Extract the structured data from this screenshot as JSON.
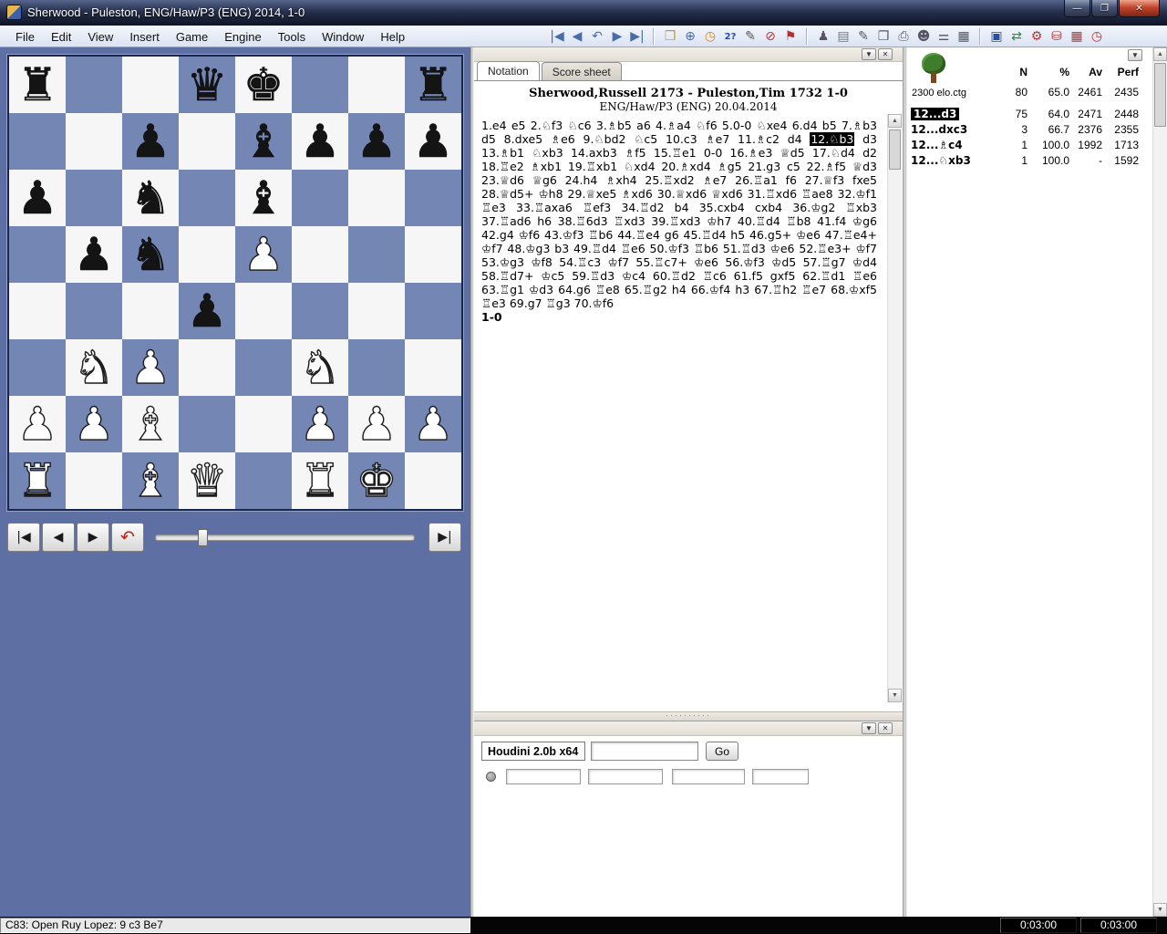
{
  "window": {
    "title": "Sherwood - Puleston, ENG/Haw/P3 (ENG) 2014, 1-0",
    "buttons": {
      "minimize": "—",
      "maximize": "❐",
      "close": "✕"
    }
  },
  "menu": {
    "items": [
      "File",
      "Edit",
      "View",
      "Insert",
      "Game",
      "Engine",
      "Tools",
      "Window",
      "Help"
    ]
  },
  "toolbar": {
    "icons": [
      {
        "name": "goto-start-icon",
        "glyph": "|◀",
        "color": "#4a6da8"
      },
      {
        "name": "back-icon",
        "glyph": "◀",
        "color": "#4a6da8"
      },
      {
        "name": "unplay-move-icon",
        "glyph": "↶",
        "color": "#4a6da8"
      },
      {
        "name": "forward-icon",
        "glyph": "▶",
        "color": "#4a6da8"
      },
      {
        "name": "goto-end-icon",
        "glyph": "▶|",
        "color": "#4a6da8"
      },
      {
        "sep": true
      },
      {
        "name": "new-game-folder-icon",
        "glyph": "❒",
        "color": "#c09a2e"
      },
      {
        "name": "globe-icon",
        "glyph": "⊕",
        "color": "#3a6fb0"
      },
      {
        "name": "clock-icon",
        "glyph": "◷",
        "color": "#d9861f"
      },
      {
        "name": "training-icon",
        "glyph": "2?",
        "color": "#2a4fa0",
        "small": true
      },
      {
        "name": "annotate-pencil-icon",
        "glyph": "✎",
        "color": "#555555"
      },
      {
        "name": "no-entry-icon",
        "glyph": "⊘",
        "color": "#c23333"
      },
      {
        "name": "flag-icon",
        "glyph": "⚑",
        "color": "#b03030"
      },
      {
        "sep": true
      },
      {
        "name": "best-line-icon",
        "glyph": "♟",
        "color": "#555566"
      },
      {
        "name": "opening-book-icon",
        "glyph": "▤",
        "color": "#777777"
      },
      {
        "name": "edit-game-data-icon",
        "glyph": "✎",
        "color": "#556"
      },
      {
        "name": "new-board-window-icon",
        "glyph": "❐",
        "color": "#556"
      },
      {
        "name": "print-icon",
        "glyph": "⎙",
        "color": "#556"
      },
      {
        "name": "player-info-icon",
        "glyph": "☻",
        "color": "#556"
      },
      {
        "name": "material-columns-icon",
        "glyph": "⚌",
        "color": "#556"
      },
      {
        "name": "board-grid-icon",
        "glyph": "▦",
        "color": "#556"
      },
      {
        "sep": true
      },
      {
        "name": "save-game-icon",
        "glyph": "▣",
        "color": "#2a4fa0"
      },
      {
        "name": "replace-game-icon",
        "glyph": "⇄",
        "color": "#2a8f3a"
      },
      {
        "name": "engine-gear-icon",
        "glyph": "⚙",
        "color": "#b33333"
      },
      {
        "name": "database-icon",
        "glyph": "⛁",
        "color": "#b33333"
      },
      {
        "name": "red-board-icon",
        "glyph": "▦",
        "color": "#b33333"
      },
      {
        "name": "red-clock-icon",
        "glyph": "◷",
        "color": "#b33333"
      }
    ]
  },
  "board": {
    "light_color": "#f6f6f6",
    "dark_color": "#7486b4",
    "pieces": [
      {
        "square": "a8",
        "color": "b",
        "type": "rook",
        "glyph": "♜"
      },
      {
        "square": "d8",
        "color": "b",
        "type": "queen",
        "glyph": "♛"
      },
      {
        "square": "e8",
        "color": "b",
        "type": "king",
        "glyph": "♚"
      },
      {
        "square": "h8",
        "color": "b",
        "type": "rook",
        "glyph": "♜"
      },
      {
        "square": "c7",
        "color": "b",
        "type": "pawn",
        "glyph": "♟"
      },
      {
        "square": "e7",
        "color": "b",
        "type": "bishop",
        "glyph": "♝"
      },
      {
        "square": "f7",
        "color": "b",
        "type": "pawn",
        "glyph": "♟"
      },
      {
        "square": "g7",
        "color": "b",
        "type": "pawn",
        "glyph": "♟"
      },
      {
        "square": "h7",
        "color": "b",
        "type": "pawn",
        "glyph": "♟"
      },
      {
        "square": "a6",
        "color": "b",
        "type": "pawn",
        "glyph": "♟"
      },
      {
        "square": "c6",
        "color": "b",
        "type": "knight",
        "glyph": "♞"
      },
      {
        "square": "e6",
        "color": "b",
        "type": "bishop",
        "glyph": "♝"
      },
      {
        "square": "b5",
        "color": "b",
        "type": "pawn",
        "glyph": "♟"
      },
      {
        "square": "c5",
        "color": "b",
        "type": "knight",
        "glyph": "♞"
      },
      {
        "square": "e5",
        "color": "w",
        "type": "pawn",
        "glyph": "♟"
      },
      {
        "square": "d4",
        "color": "b",
        "type": "pawn",
        "glyph": "♟"
      },
      {
        "square": "b3",
        "color": "w",
        "type": "knight",
        "glyph": "♞"
      },
      {
        "square": "c3",
        "color": "w",
        "type": "pawn",
        "glyph": "♟"
      },
      {
        "square": "f3",
        "color": "w",
        "type": "knight",
        "glyph": "♞"
      },
      {
        "square": "a2",
        "color": "w",
        "type": "pawn",
        "glyph": "♟"
      },
      {
        "square": "b2",
        "color": "w",
        "type": "pawn",
        "glyph": "♟"
      },
      {
        "square": "c2",
        "color": "w",
        "type": "bishop",
        "glyph": "♝"
      },
      {
        "square": "f2",
        "color": "w",
        "type": "pawn",
        "glyph": "♟"
      },
      {
        "square": "g2",
        "color": "w",
        "type": "pawn",
        "glyph": "♟"
      },
      {
        "square": "h2",
        "color": "w",
        "type": "pawn",
        "glyph": "♟"
      },
      {
        "square": "a1",
        "color": "w",
        "type": "rook",
        "glyph": "♜"
      },
      {
        "square": "c1",
        "color": "w",
        "type": "bishop",
        "glyph": "♝"
      },
      {
        "square": "d1",
        "color": "w",
        "type": "queen",
        "glyph": "♛"
      },
      {
        "square": "f1",
        "color": "w",
        "type": "rook",
        "glyph": "♜"
      },
      {
        "square": "g1",
        "color": "w",
        "type": "king",
        "glyph": "♚"
      }
    ]
  },
  "board_controls": {
    "buttons": [
      {
        "name": "board-goto-start-button",
        "glyph": "|◀"
      },
      {
        "name": "board-back-button",
        "glyph": "◀"
      },
      {
        "name": "board-forward-button",
        "glyph": "▶"
      },
      {
        "name": "board-unplay-button",
        "glyph": "↶"
      },
      {
        "name": "board-goto-end-button",
        "glyph": "▶|"
      }
    ],
    "slider_position": 0.17
  },
  "panel_buttons": {
    "menu": "▼",
    "close": "✕"
  },
  "scrollbar": {
    "up": "▲",
    "down": "▼"
  },
  "notation_panel": {
    "tabs": [
      "Notation",
      "Score sheet"
    ],
    "header_line1": "Sherwood,Russell 2173 - Puleston,Tim 1732  1-0",
    "header_line2": "ENG/Haw/P3 (ENG) 20.04.2014",
    "moves_before": "1.e4 e5 2.♘f3 ♘c6 3.♗b5 a6 4.♗a4 ♘f6 5.0-0 ♘xe4 6.d4 b5 7.♗b3 d5 8.dxe5 ♗e6 9.♘bd2 ♘c5 10.c3 ♗e7 11.♗c2 d4 ",
    "current_move": "12.♘b3",
    "moves_after": " d3 13.♗b1 ♘xb3 14.axb3 ♗f5 15.♖e1 0-0 16.♗e3 ♕d5 17.♘d4 d2 18.♖e2 ♗xb1 19.♖xb1 ♘xd4 20.♗xd4 ♗g5 21.g3 c5 22.♗f5 ♕d3 23.♕d6 ♕g6 24.h4 ♗xh4 25.♖xd2 ♗e7 26.♖a1 f6 27.♕f3 fxe5 28.♕d5+ ♔h8 29.♕xe5 ♗xd6 30.♕xd6 ♕xd6 31.♖xd6 ♖ae8 32.♔f1 ♖e3 33.♖axa6 ♖ef3 34.♖d2 b4 35.cxb4 cxb4 36.♔g2 ♖xb3 37.♖ad6 h6 38.♖6d3 ♖xd3 39.♖xd3 ♔h7 40.♖d4 ♖b8 41.f4 ♔g6 42.g4 ♔f6 43.♔f3 ♖b6 44.♖e4 g6 45.♖d4 h5 46.g5+ ♔e6 47.♖e4+ ♔f7 48.♔g3 b3 49.♖d4 ♖e6 50.♔f3 ♖b6 51.♖d3 ♔e6 52.♖e3+ ♔f7 53.♔g3 ♔f8 54.♖c3 ♔f7 55.♖c7+ ♔e6 56.♔f3 ♔d5 57.♖g7 ♔d4 58.♖d7+ ♔c5 59.♖d3 ♔c4 60.♖d2 ♖c6 61.f5 gxf5 62.♖d1 ♖e6 63.♖g1 ♔d3 64.g6 ♖e8 65.♖g2 h4 66.♔f4 h3 67.♖h2 ♖e7 68.♔xf5 ♖e3 69.g7 ♖g3 70.♔f6",
    "result": "1-0",
    "splitter_dots": "··········"
  },
  "engine_panel": {
    "engine_name": "Houdini 2.0b x64",
    "input_value": "",
    "go_label": "Go",
    "fields": [
      "",
      "",
      "",
      ""
    ]
  },
  "tree_panel": {
    "book_name": "2300 elo.ctg",
    "columns": [
      "N",
      "%",
      "Av",
      "Perf"
    ],
    "totals": {
      "n": "80",
      "pct": "65.0",
      "av": "2461",
      "perf": "2435"
    },
    "rows": [
      {
        "move": "12...d3",
        "n": "75",
        "pct": "64.0",
        "av": "2471",
        "perf": "2448",
        "selected": true
      },
      {
        "move": "12...dxc3",
        "n": "3",
        "pct": "66.7",
        "av": "2376",
        "perf": "2355",
        "selected": false
      },
      {
        "move": "12...♗c4",
        "n": "1",
        "pct": "100.0",
        "av": "1992",
        "perf": "1713",
        "selected": false
      },
      {
        "move": "12...♘xb3",
        "n": "1",
        "pct": "100.0",
        "av": "-",
        "perf": "1592",
        "selected": false
      }
    ]
  },
  "status_bar": {
    "eco": "C83: Open Ruy Lopez: 9 c3 Be7",
    "clock_white": "0:03:00",
    "clock_black": "0:03:00"
  }
}
